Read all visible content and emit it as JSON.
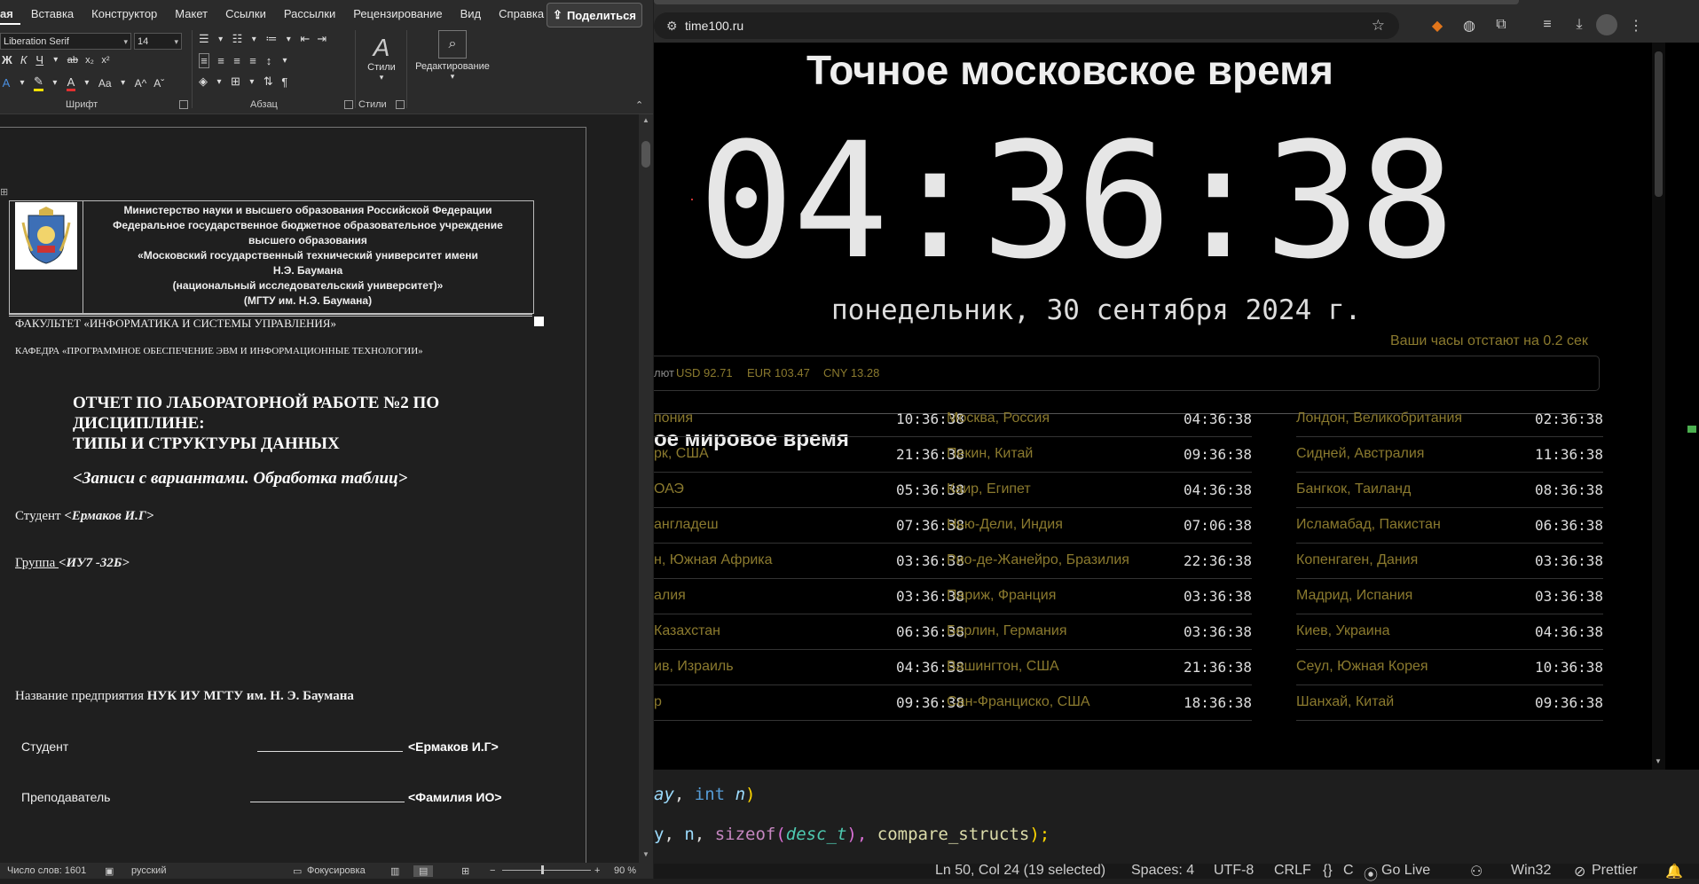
{
  "word": {
    "tabs": [
      "ая",
      "Вставка",
      "Конструктор",
      "Макет",
      "Ссылки",
      "Рассылки",
      "Рецензирование",
      "Вид",
      "Справка"
    ],
    "share_label": "Поделиться",
    "font_name": "Liberation Serif",
    "font_size": "14",
    "groups": {
      "font": "Шрифт",
      "paragraph": "Абзац",
      "styles": "Стили"
    },
    "styles_button": "Стили",
    "editing_button": "Редактирование",
    "header_lines": [
      "Министерство науки и высшего образования Российской Федерации",
      "Федеральное государственное бюджетное образовательное учреждение",
      "высшего образования",
      "«Московский государственный технический университет имени",
      "Н.Э. Баумана",
      "(национальный исследовательский университет)»",
      "(МГТУ им. Н.Э. Баумана)"
    ],
    "faculty": "ФАКУЛЬТЕТ «ИНФОРМАТИКА И СИСТЕМЫ УПРАВЛЕНИЯ»",
    "department": "КАФЕДРА «ПРОГРАММНОЕ ОБЕСПЕЧЕНИЕ ЭВМ И ИНФОРМАЦИОННЫЕ ТЕХНОЛОГИИ»",
    "title_lines": [
      "ОТЧЕТ ПО ЛАБОРАТОРНОЙ РАБОТЕ №2 ПО",
      "ДИСЦИПЛИНЕ:",
      "ТИПЫ И СТРУКТУРЫ ДАННЫХ"
    ],
    "subtitle": "<Записи с вариантами. Обработка таблиц>",
    "student_label": "Студент ",
    "student_name": "<Ермаков И.Г>",
    "group_label": "Группа ",
    "group_value": "<ИУ7 -32Б>",
    "enterprise_label": "Название предприятия ",
    "enterprise_value": "НУК ИУ МГТУ им. Н. Э. Баумана",
    "sign_student_label": "Студент",
    "sign_student_value": "<Ермаков И.Г>",
    "sign_teacher_label": "Преподаватель",
    "sign_teacher_value": "<Фамилия ИО>",
    "status": {
      "words": "Число слов: 1601",
      "language": "русский",
      "focus": "Фокусировка",
      "zoom": "90 %"
    }
  },
  "browser": {
    "url": "time100.ru",
    "page_title": "Точное московское время",
    "clock": "04:36:38",
    "date": "понедельник, 30 сентября 2024 г.",
    "lag_notice": "Ваши часы отстают на 0.2 сек",
    "rates_label": "лют",
    "rates": [
      "USD 92.71",
      "EUR 103.47",
      "CNY 13.28"
    ],
    "world_title": "ое мировое время",
    "columns": [
      [
        {
          "city": "пония",
          "time": "10:36:38"
        },
        {
          "city": "рк, США",
          "time": "21:36:38"
        },
        {
          "city": "ОАЭ",
          "time": "05:36:38"
        },
        {
          "city": "англадеш",
          "time": "07:36:38"
        },
        {
          "city": "н, Южная Африка",
          "time": "03:36:38"
        },
        {
          "city": "алия",
          "time": "03:36:38"
        },
        {
          "city": "Казахстан",
          "time": "06:36:38"
        },
        {
          "city": "ив, Израиль",
          "time": "04:36:38"
        },
        {
          "city": "р",
          "time": "09:36:38"
        }
      ],
      [
        {
          "city": "Москва, Россия",
          "time": "04:36:38"
        },
        {
          "city": "Пекин, Китай",
          "time": "09:36:38"
        },
        {
          "city": "Каир, Египет",
          "time": "04:36:38"
        },
        {
          "city": "Нью-Дели, Индия",
          "time": "07:06:38"
        },
        {
          "city": "Рио-де-Жанейро, Бразилия",
          "time": "22:36:38"
        },
        {
          "city": "Париж, Франция",
          "time": "03:36:38"
        },
        {
          "city": "Берлин, Германия",
          "time": "03:36:38"
        },
        {
          "city": "Вашингтон, США",
          "time": "21:36:38"
        },
        {
          "city": "Сан-Франциско, США",
          "time": "18:36:38"
        }
      ],
      [
        {
          "city": "Лондон, Великобритания",
          "time": "02:36:38"
        },
        {
          "city": "Сидней, Австралия",
          "time": "11:36:38"
        },
        {
          "city": "Бангкок, Таиланд",
          "time": "08:36:38"
        },
        {
          "city": "Исламабад, Пакистан",
          "time": "06:36:38"
        },
        {
          "city": "Копенгаген, Дания",
          "time": "03:36:38"
        },
        {
          "city": "Мадрид, Испания",
          "time": "03:36:38"
        },
        {
          "city": "Киев, Украина",
          "time": "04:36:38"
        },
        {
          "city": "Сеул, Южная Корея",
          "time": "10:36:38"
        },
        {
          "city": "Шанхай, Китай",
          "time": "09:36:38"
        }
      ]
    ]
  },
  "editor": {
    "line1": {
      "a": "ay",
      "b": ", ",
      "c": "int",
      "d": " ",
      "e": "n",
      "f": ")"
    },
    "line2": {
      "a": "y",
      "b": ", ",
      "c": "n",
      "d": ", ",
      "e": "sizeof",
      "f": "(",
      "g": "desc_t",
      "h": "), ",
      "i": "compare_structs",
      "j": ");"
    },
    "status": {
      "position": "Ln 50, Col 24 (19 selected)",
      "spaces": "Spaces: 4",
      "encoding": "UTF-8",
      "eol": "CRLF",
      "language": "C",
      "golive": "Go Live",
      "platform": "Win32",
      "prettier": "Prettier"
    }
  },
  "colors": {
    "accent_gold": "#8b7a2e",
    "keyword": "#569cd6",
    "function": "#dcdcaa",
    "param": "#9cdcfe",
    "type": "#4ec9b0"
  }
}
